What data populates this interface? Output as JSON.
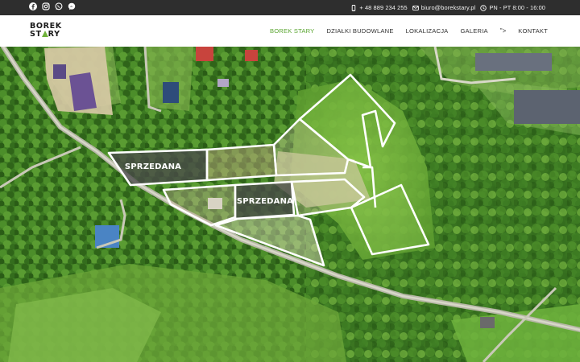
{
  "topbar": {
    "social_icons": [
      "facebook-icon",
      "instagram-icon",
      "whatsapp-icon",
      "messenger-icon"
    ],
    "phone": "+ 48 889 234 255",
    "email": "biuro@borekstary.pl",
    "hours": "PN - PT 8:00 - 16:00"
  },
  "logo": {
    "line1": "BOREK",
    "line2_a": "ST",
    "line2_b": "RY"
  },
  "nav": {
    "items": [
      {
        "label": "BOREK STARY",
        "active": true
      },
      {
        "label": "DZIAŁKI BUDOWLANE",
        "active": false
      },
      {
        "label": "LOKALIZACJA",
        "active": false
      },
      {
        "label": "GALERIA",
        "active": false
      }
    ],
    "more": "\">",
    "contact": "KONTAKT"
  },
  "hero": {
    "sold_label_1": "SPRZEDANA",
    "sold_label_2": "SPRZEDANA"
  },
  "colors": {
    "accent": "#5aa530",
    "topbar": "#2e2e2e",
    "plot_outline": "#ffffff",
    "sold_fill": "#4a4a4a"
  }
}
